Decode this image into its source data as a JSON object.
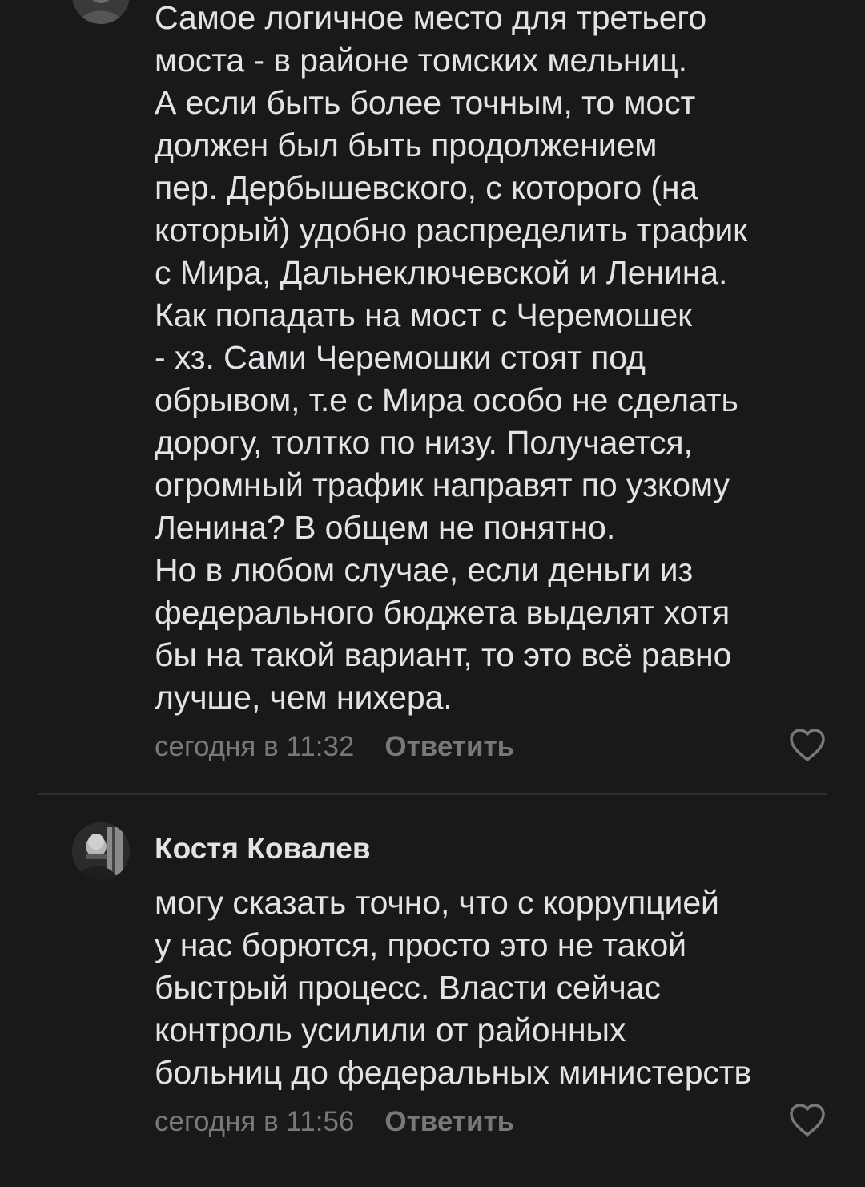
{
  "comments": [
    {
      "text": "Самое логичное место для третьего\nмоста - в районе томских мельниц.\nА если быть более точным, то мост\nдолжен был быть продолжением\nпер. Дербышевского, с которого (на\nкоторый) удобно распределить трафик\nс Мира, Дальнеключевской и Ленина.\nКак попадать на мост с Черемошек\n- хз. Сами Черемошки стоят под\nобрывом, т.е с Мира особо не сделать\nдорогу, толтко по низу. Получается,\nогромный трафик направят по узкому\nЛенина? В общем не понятно.\nНо в любом случае, если деньги из\nфедерального бюджета выделят хотя\nбы на такой вариант, то это всё равно\nлучше, чем нихера.",
      "time": "сегодня в 11:32",
      "reply_label": "Ответить",
      "like_icon": "heart-outline-icon"
    },
    {
      "author": "Костя Ковалев",
      "text": "могу сказать точно, что с коррупцией\nу нас борются, просто это не такой\nбыстрый процесс. Власти сейчас\nконтроль усилили от районных\nбольниц до федеральных министерств",
      "time": "сегодня в 11:56",
      "reply_label": "Ответить",
      "like_icon": "heart-outline-icon"
    }
  ],
  "colors": {
    "background": "#191919",
    "text": "#e1e3e6",
    "secondary_text": "#76787a",
    "divider": "#2f2f2f"
  }
}
